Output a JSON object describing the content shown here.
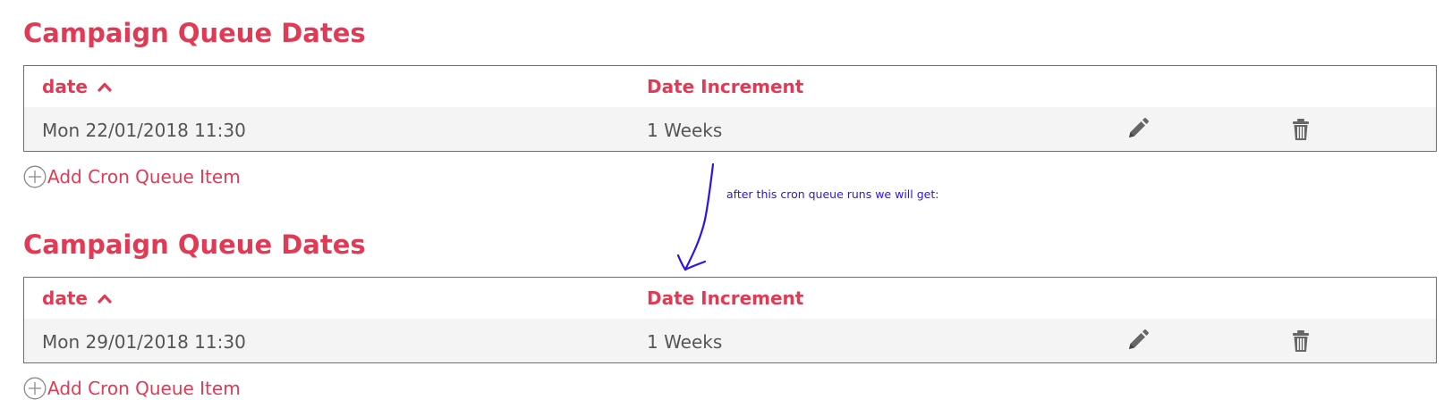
{
  "sections": [
    {
      "title": "Campaign Queue Dates",
      "columns": {
        "date": "date",
        "increment": "Date Increment"
      },
      "row": {
        "date": "Mon 22/01/2018 11:30",
        "increment": "1 Weeks"
      },
      "add_label": "Add Cron Queue Item"
    },
    {
      "title": "Campaign Queue Dates",
      "columns": {
        "date": "date",
        "increment": "Date Increment"
      },
      "row": {
        "date": "Mon 29/01/2018 11:30",
        "increment": "1 Weeks"
      },
      "add_label": "Add Cron Queue Item"
    }
  ],
  "annotation": {
    "text": "after this cron queue runs we will get:"
  },
  "icons": {
    "sort": "chevron-up-icon",
    "edit": "pencil-icon",
    "delete": "trash-icon",
    "add": "plus-circle-icon"
  },
  "colors": {
    "accent": "#e03a55",
    "text": "#555555",
    "row_bg": "#f4f4f5",
    "border": "#6e6e6e",
    "annotation": "#2a14e6",
    "icon": "#666666"
  }
}
